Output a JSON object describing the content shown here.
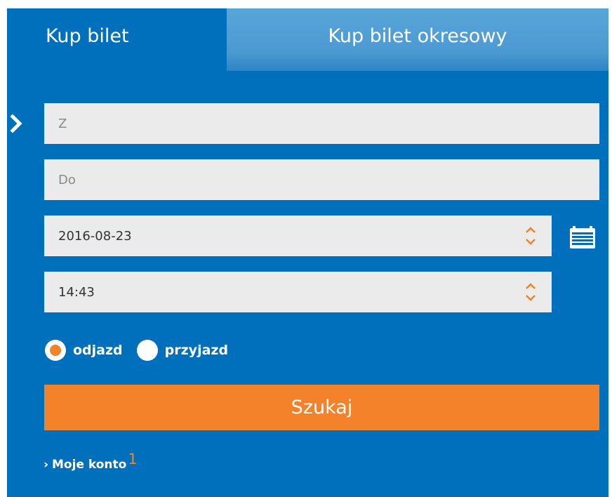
{
  "tabs": {
    "active_label": "Kup bilet",
    "inactive_label": "Kup bilet okresowy"
  },
  "form": {
    "from_placeholder": "Z",
    "to_placeholder": "Do",
    "date_value": "2016-08-23",
    "time_value": "14:43"
  },
  "direction": {
    "departure_label": "odjazd",
    "arrival_label": "przyjazd",
    "selected": "odjazd"
  },
  "search_label": "Szukaj",
  "account": {
    "arrow": "›",
    "label": "Moje konto",
    "badge": "1"
  },
  "colors": {
    "panel": "#0070bd",
    "accent": "#f3822a",
    "field": "#ebebeb"
  },
  "icons": {
    "row_marker": "chevron-right-icon",
    "spinner": "spinner-icon",
    "calendar": "calendar-icon"
  }
}
